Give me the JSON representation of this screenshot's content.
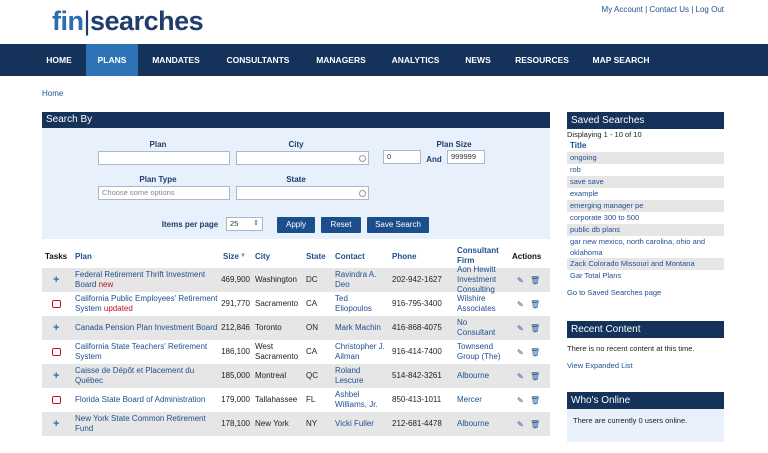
{
  "logo": {
    "fin": "fin",
    "bar": "|",
    "searches": "searches"
  },
  "userlinks": {
    "account": "My Account",
    "sep1": " | ",
    "contact": "Contact Us",
    "sep2": " | ",
    "logout": "Log Out"
  },
  "nav": [
    {
      "label": "HOME"
    },
    {
      "label": "PLANS"
    },
    {
      "label": "MANDATES"
    },
    {
      "label": "CONSULTANTS"
    },
    {
      "label": "MANAGERS"
    },
    {
      "label": "ANALYTICS"
    },
    {
      "label": "NEWS"
    },
    {
      "label": "RESOURCES"
    },
    {
      "label": "MAP SEARCH"
    }
  ],
  "breadcrumb": "Home",
  "search": {
    "title": "Search By",
    "plan_label": "Plan",
    "city_label": "City",
    "plansize_label": "Plan Size",
    "plansize_min": "0",
    "and_label": "And",
    "plansize_max": "999999",
    "plantype_label": "Plan Type",
    "plantype_placeholder": "Choose some options",
    "state_label": "State",
    "items_label": "Items per page",
    "items_value": "25",
    "apply": "Apply",
    "reset": "Reset",
    "save": "Save Search"
  },
  "table": {
    "headers": {
      "tasks": "Tasks",
      "plan": "Plan",
      "size": "Size",
      "city": "City",
      "state": "State",
      "contact": "Contact",
      "phone": "Phone",
      "firm": "Consultant Firm",
      "actions": "Actions"
    },
    "rows": [
      {
        "plan": "Federal Retirement Thrift Investment Board",
        "tag": " new",
        "size": "469,900",
        "city": "Washington",
        "state": "DC",
        "contact": "Ravindra A. Deo",
        "phone": "202-942-1627",
        "firm": "Aon Hewitt Investment Consulting"
      },
      {
        "plan": "California Public Employees' Retirement System",
        "tag": " updated",
        "size": "291,770",
        "city": "Sacramento",
        "state": "CA",
        "contact": "Ted Eliopoulos",
        "phone": "916-795-3400",
        "firm": "Wilshire Associates"
      },
      {
        "plan": "Canada Pension Plan Investment Board",
        "tag": "",
        "size": "212,846",
        "city": "Toronto",
        "state": "ON",
        "contact": "Mark Machin",
        "phone": "416-868-4075",
        "firm": "No Consultant"
      },
      {
        "plan": "California State Teachers' Retirement System",
        "tag": "",
        "size": "186,100",
        "city": "West Sacramento",
        "state": "CA",
        "contact": "Christopher J. Ailman",
        "phone": "916-414-7400",
        "firm": "Townsend Group (The)"
      },
      {
        "plan": "Caisse de Dépôt et Placement du Québec",
        "tag": "",
        "size": "185,000",
        "city": "Montreal",
        "state": "QC",
        "contact": "Roland Lescure",
        "phone": "514-842-3261",
        "firm": "Albourne"
      },
      {
        "plan": "Florida State Board of Administration",
        "tag": "",
        "size": "179,000",
        "city": "Tallahassee",
        "state": "FL",
        "contact": "Ashbel Williams, Jr.",
        "phone": "850-413-1011",
        "firm": "Mercer"
      },
      {
        "plan": "New York State Common Retirement Fund",
        "tag": "",
        "size": "178,100",
        "city": "New York",
        "state": "NY",
        "contact": "Vicki Fuller",
        "phone": "212-681-4478",
        "firm": "Albourne"
      }
    ]
  },
  "saved": {
    "title": "Saved Searches",
    "count": "Displaying 1 - 10 of 10",
    "col": "Title",
    "items": [
      "ongoing",
      "rob",
      "save save",
      "example",
      "emerging manager pe",
      "corporate 300 to 500",
      "public db plans",
      "gar new mexico, north carolina, ohio and oklahoma",
      "Zack Colorado Missouri and Montana",
      "Gar Total Plans"
    ],
    "goto": "Go to Saved Searches page"
  },
  "recent": {
    "title": "Recent Content",
    "text": "There is no recent content at this time.",
    "link": "View Expanded List"
  },
  "online": {
    "title": "Who's Online",
    "text": "There are currently 0 users online."
  },
  "colors": {
    "navy": "#14325a",
    "active": "#2f73b7",
    "link": "#1f4f8f",
    "new_tag": "#c0102a"
  }
}
